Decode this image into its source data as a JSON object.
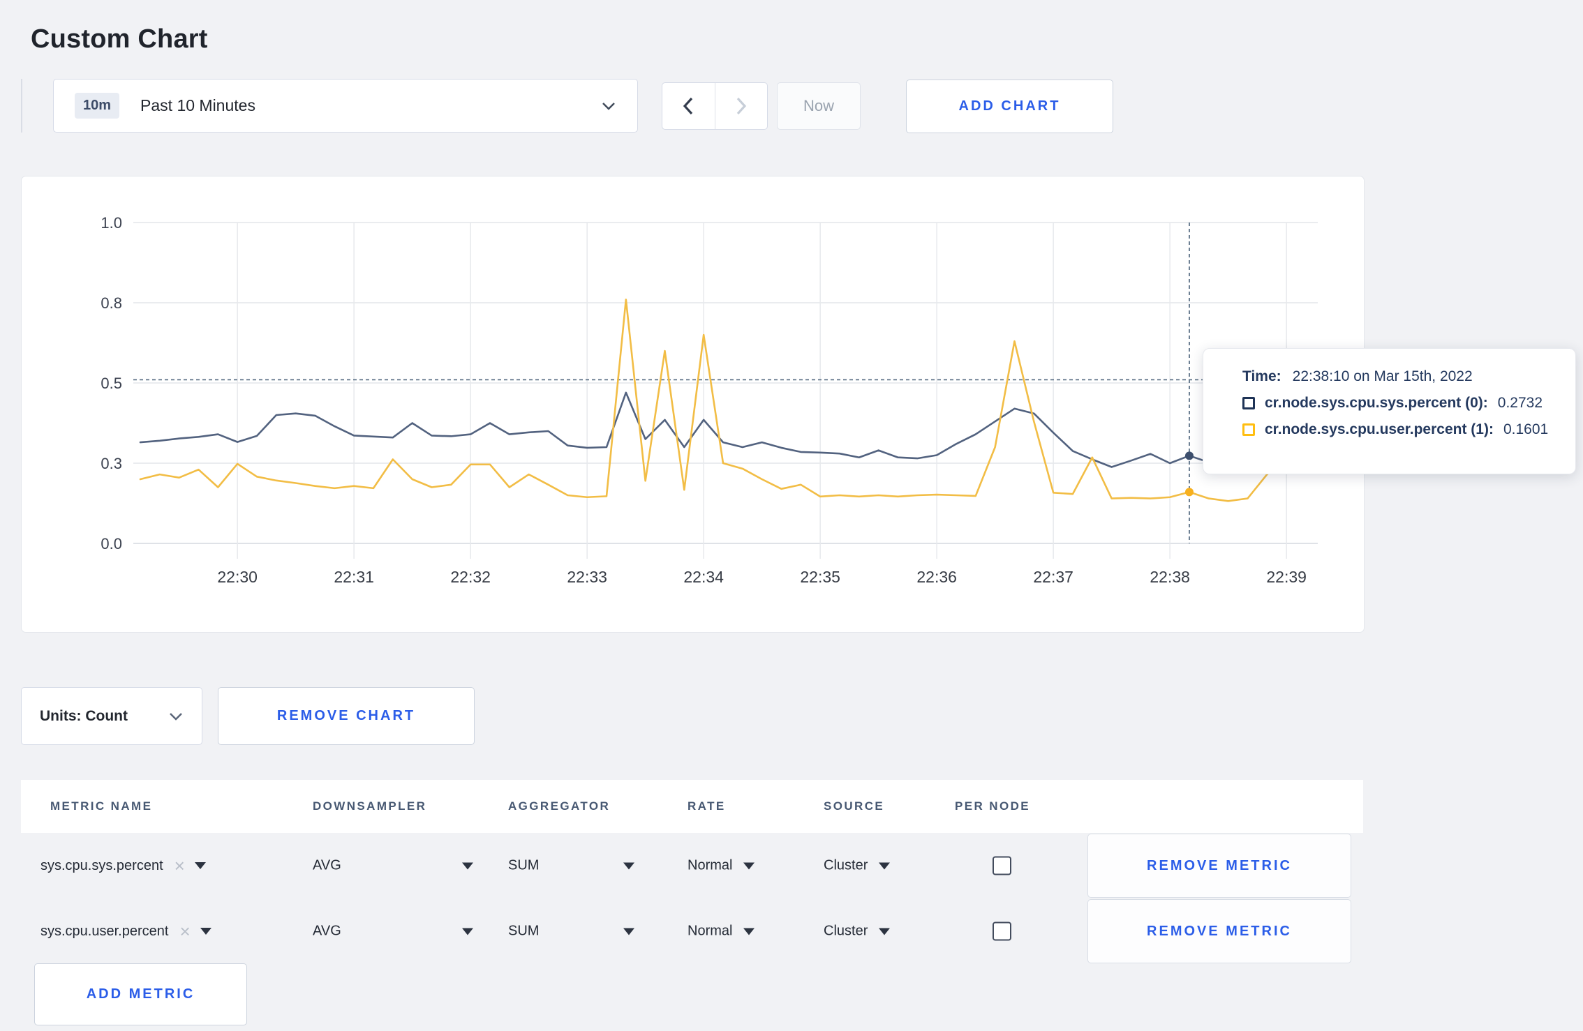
{
  "page": {
    "title": "Custom Chart"
  },
  "toolbar": {
    "time_badge": "10m",
    "time_label": "Past 10 Minutes",
    "now_label": "Now",
    "add_chart_label": "ADD CHART"
  },
  "chart_controls": {
    "units_label": "Units: Count",
    "remove_chart_label": "REMOVE CHART"
  },
  "chart_data": {
    "type": "line",
    "title": "",
    "xlabel": "",
    "ylabel": "",
    "ylim": [
      0,
      1
    ],
    "grid": true,
    "y_tick_labels": [
      "0.0",
      "0.3",
      "0.5",
      "0.8",
      "1.0"
    ],
    "y_tick_positions": [
      0,
      0.25,
      0.5,
      0.75,
      1.0
    ],
    "x_start_time": "22:29:10",
    "x_step_seconds": 10,
    "x_tick_labels": [
      "22:30",
      "22:31",
      "22:32",
      "22:33",
      "22:34",
      "22:35",
      "22:36",
      "22:37",
      "22:38",
      "22:39"
    ],
    "x_tick_indices": [
      5,
      11,
      17,
      23,
      29,
      35,
      41,
      47,
      53,
      59
    ],
    "crosshair": {
      "x_index": 54,
      "time": "22:38:10",
      "hline_value": 0.51
    },
    "series": [
      {
        "name": "cr.node.sys.cpu.sys.percent (0)",
        "color": "#52627f",
        "dot_color": "#3d4f6d",
        "values": [
          0.315,
          0.32,
          0.327,
          0.332,
          0.34,
          0.316,
          0.335,
          0.4,
          0.405,
          0.398,
          0.365,
          0.336,
          0.333,
          0.33,
          0.375,
          0.336,
          0.334,
          0.34,
          0.375,
          0.34,
          0.346,
          0.35,
          0.305,
          0.298,
          0.3,
          0.47,
          0.325,
          0.385,
          0.3,
          0.385,
          0.315,
          0.3,
          0.315,
          0.298,
          0.285,
          0.283,
          0.28,
          0.268,
          0.29,
          0.268,
          0.265,
          0.275,
          0.31,
          0.34,
          0.38,
          0.42,
          0.405,
          0.345,
          0.288,
          0.262,
          0.238,
          0.258,
          0.279,
          0.25,
          0.2732,
          0.253,
          0.25,
          0.252,
          0.25,
          0.251,
          0.25
        ]
      },
      {
        "name": "cr.node.sys.cpu.user.percent (1)",
        "color": "#f2bd45",
        "dot_color": "#f7b01e",
        "values": [
          0.2,
          0.215,
          0.205,
          0.23,
          0.175,
          0.248,
          0.208,
          0.196,
          0.188,
          0.179,
          0.172,
          0.179,
          0.172,
          0.262,
          0.2,
          0.175,
          0.183,
          0.246,
          0.246,
          0.175,
          0.215,
          0.183,
          0.15,
          0.144,
          0.147,
          0.76,
          0.195,
          0.6,
          0.167,
          0.65,
          0.25,
          0.233,
          0.2,
          0.17,
          0.183,
          0.146,
          0.15,
          0.146,
          0.15,
          0.146,
          0.15,
          0.152,
          0.15,
          0.148,
          0.3,
          0.63,
          0.38,
          0.158,
          0.154,
          0.268,
          0.14,
          0.142,
          0.14,
          0.144,
          0.1601,
          0.14,
          0.132,
          0.14,
          0.215,
          0.268,
          0.245
        ]
      }
    ]
  },
  "tooltip": {
    "time_label": "Time:",
    "time_value": "22:38:10 on Mar 15th, 2022",
    "rows": [
      {
        "name": "cr.node.sys.cpu.sys.percent (0):",
        "value": "0.2732",
        "color": "#1e3356"
      },
      {
        "name": "cr.node.sys.cpu.user.percent (1):",
        "value": "0.1601",
        "color": "#ffbe11"
      }
    ]
  },
  "metrics_table": {
    "headers": [
      "METRIC NAME",
      "DOWNSAMPLER",
      "AGGREGATOR",
      "RATE",
      "SOURCE",
      "PER NODE"
    ],
    "rows": [
      {
        "metric": "sys.cpu.sys.percent",
        "downsampler": "AVG",
        "aggregator": "SUM",
        "rate": "Normal",
        "source": "Cluster",
        "per_node_checked": false,
        "remove_label": "REMOVE METRIC"
      },
      {
        "metric": "sys.cpu.user.percent",
        "downsampler": "AVG",
        "aggregator": "SUM",
        "rate": "Normal",
        "source": "Cluster",
        "per_node_checked": false,
        "remove_label": "REMOVE METRIC"
      }
    ],
    "add_metric_label": "ADD METRIC"
  },
  "colors": {
    "accent_blue": "#2b5de8",
    "page_background": "#f1f2f5",
    "navy_text": "#24395e",
    "series_sys": "#52627f",
    "series_user": "#f2bd45"
  }
}
